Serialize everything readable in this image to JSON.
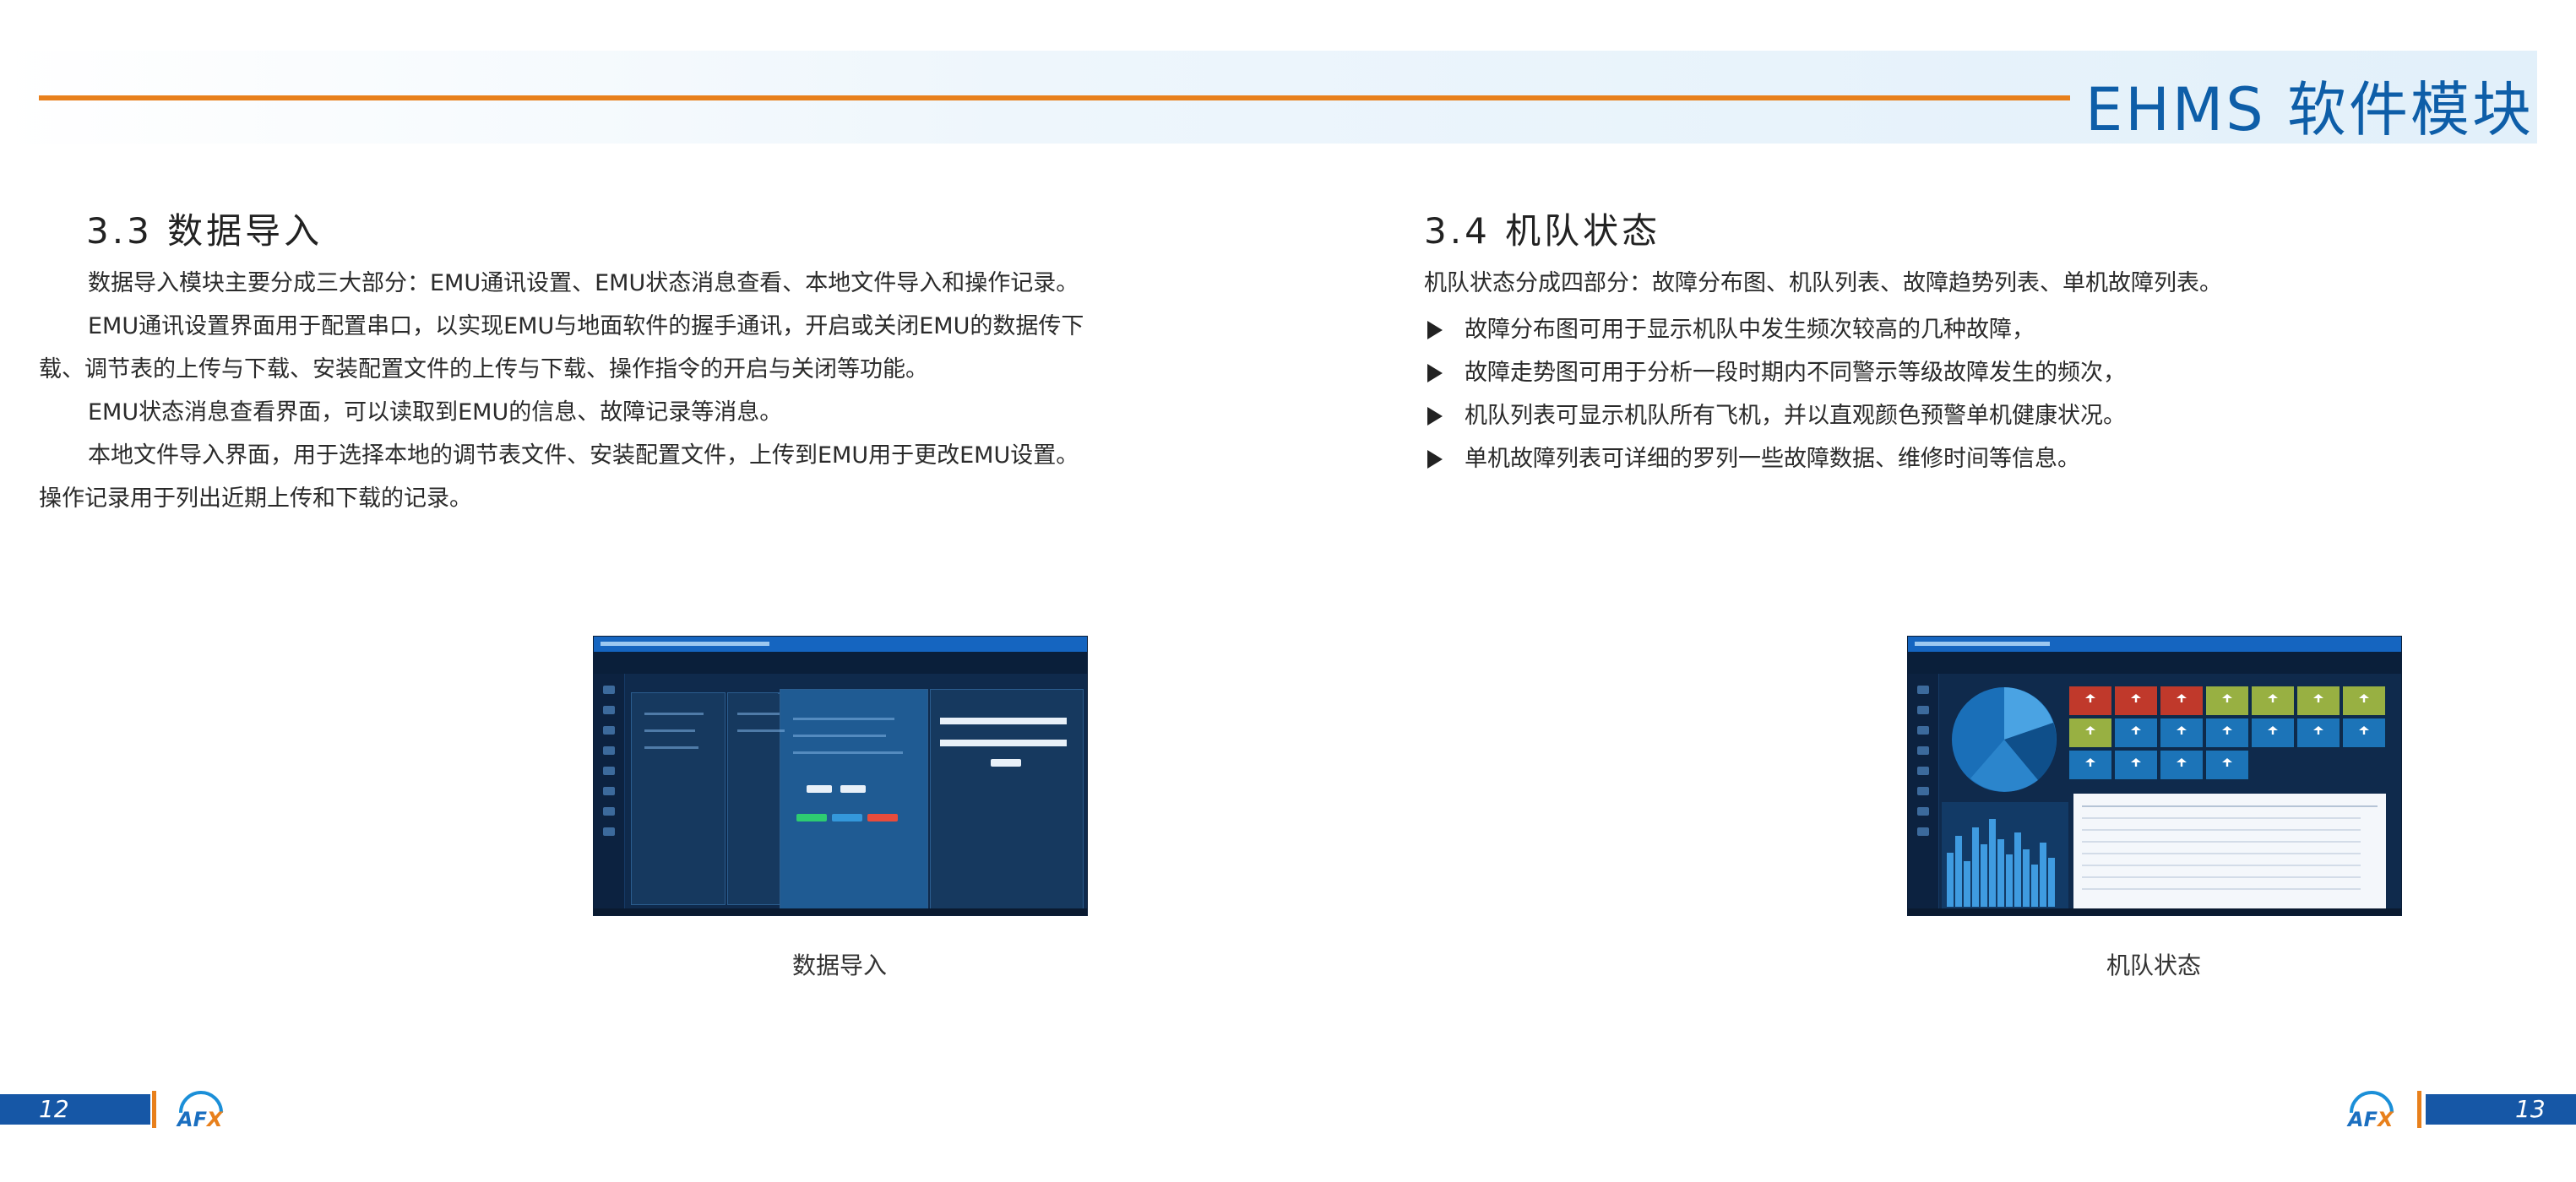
{
  "header": {
    "title": "EHMS 软件模块"
  },
  "left": {
    "section_title": "3.3 数据导入",
    "paragraphs": [
      "数据导入模块主要分成三大部分：EMU通讯设置、EMU状态消息查看、本地文件导入和操作记录。",
      "EMU通讯设置界面用于配置串口，以实现EMU与地面软件的握手通讯，开启或关闭EMU的数据传下",
      "载、调节表的上传与下载、安装配置文件的上传与下载、操作指令的开启与关闭等功能。",
      "EMU状态消息查看界面，可以读取到EMU的信息、故障记录等消息。",
      "本地文件导入界面，用于选择本地的调节表文件、安装配置文件，上传到EMU用于更改EMU设置。",
      "操作记录用于列出近期上传和下载的记录。"
    ],
    "caption": "数据导入",
    "page_number": "12"
  },
  "right": {
    "section_title": "3.4 机队状态",
    "intro": "机队状态分成四部分：故障分布图、机队列表、故障趋势列表、单机故障列表。",
    "bullets": [
      "故障分布图可用于显示机队中发生频次较高的几种故障，",
      "故障走势图可用于分析一段时期内不同警示等级故障发生的频次，",
      "机队列表可显示机队所有飞机，并以直观颜色预警单机健康状况。",
      "单机故障列表可详细的罗列一些故障数据、维修时间等信息。"
    ],
    "caption": "机队状态",
    "page_number": "13"
  },
  "colors": {
    "accent_orange": "#e8801c",
    "brand_blue": "#1657a6",
    "title_blue": "#0e5ea8"
  },
  "logo": {
    "text": "AFX"
  }
}
